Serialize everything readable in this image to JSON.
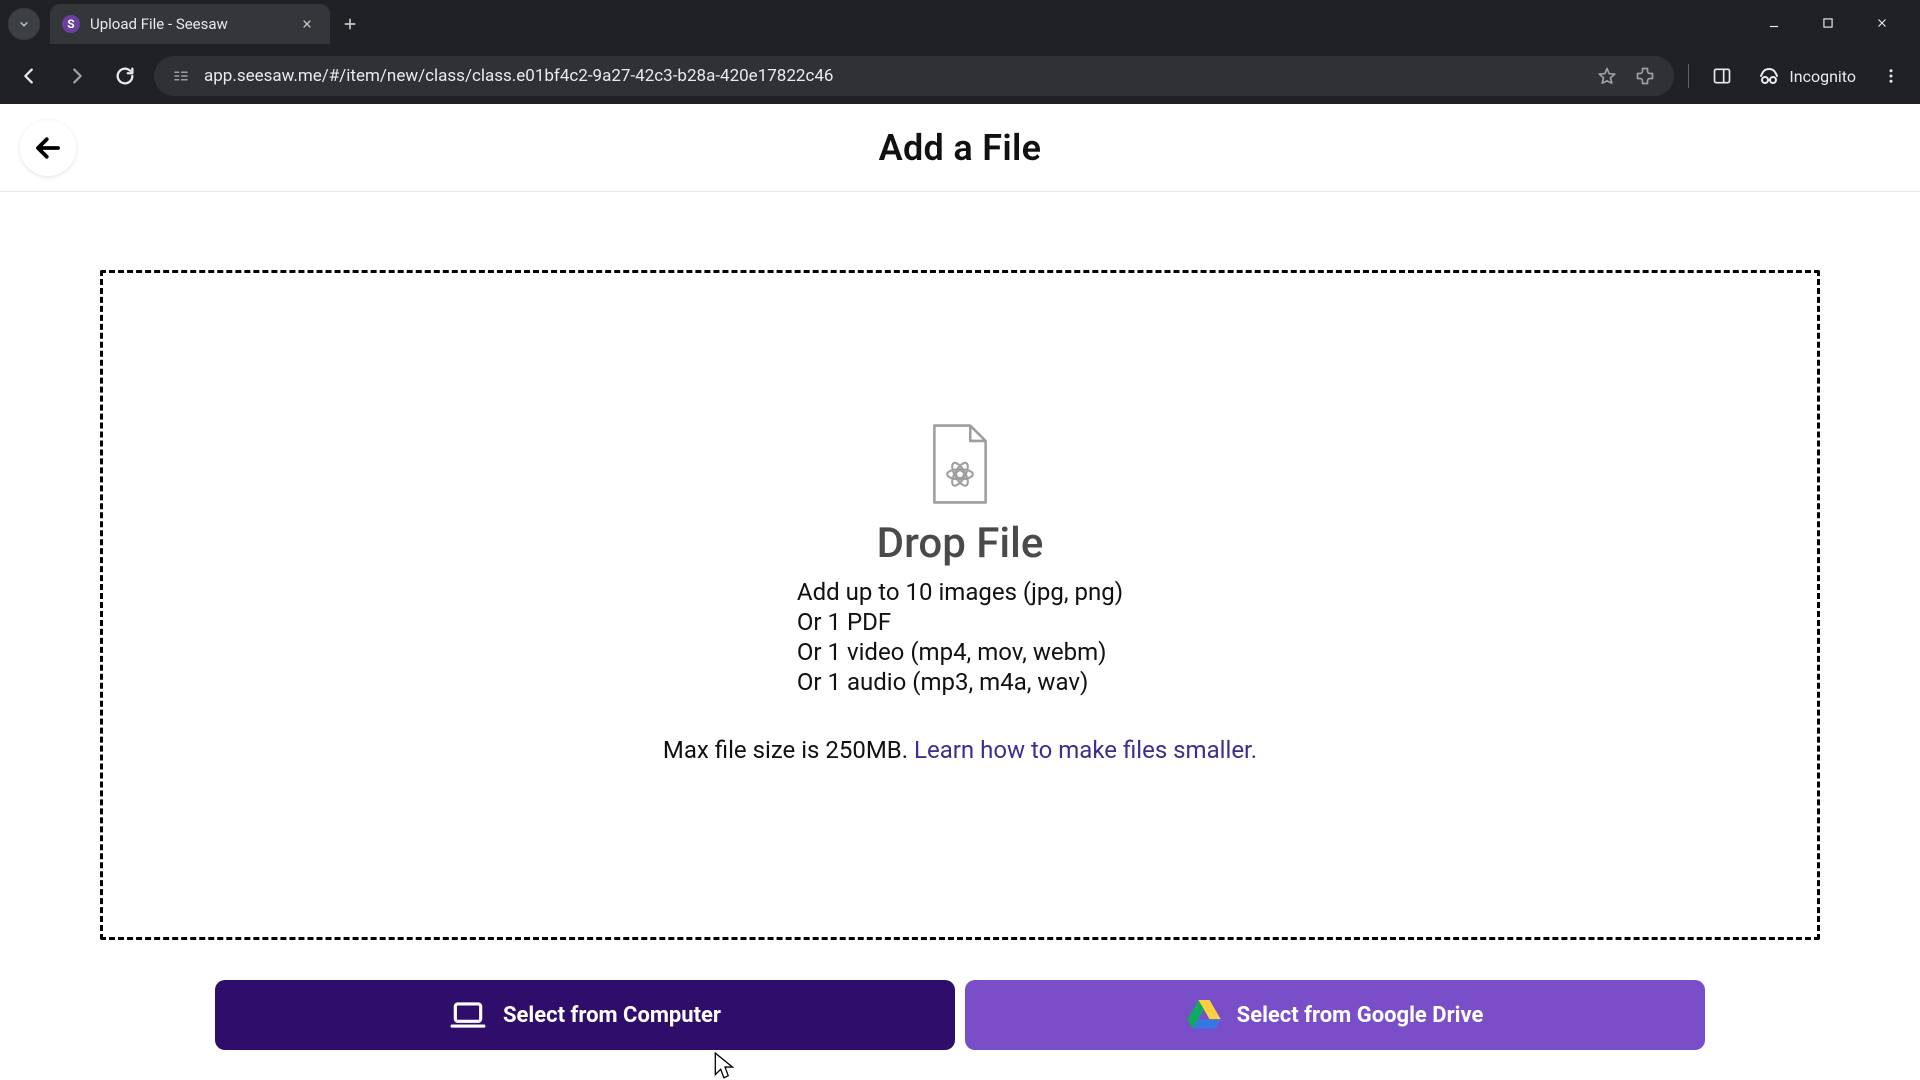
{
  "browser": {
    "tab_title": "Upload File - Seesaw",
    "url": "app.seesaw.me/#/item/new/class/class.e01bf4c2-9a27-42c3-b28a-420e17822c46",
    "incognito_label": "Incognito"
  },
  "header": {
    "title": "Add a File"
  },
  "dropzone": {
    "title": "Drop File",
    "formats": [
      "Add up to 10 images (jpg, png)",
      "Or 1 PDF",
      "Or 1 video (mp4, mov, webm)",
      "Or 1 audio (mp3, m4a, wav)"
    ],
    "max_prefix": "Max file size is 250MB. ",
    "max_link": "Learn how to make files smaller."
  },
  "buttons": {
    "computer": "Select from Computer",
    "gdrive": "Select from Google Drive"
  }
}
